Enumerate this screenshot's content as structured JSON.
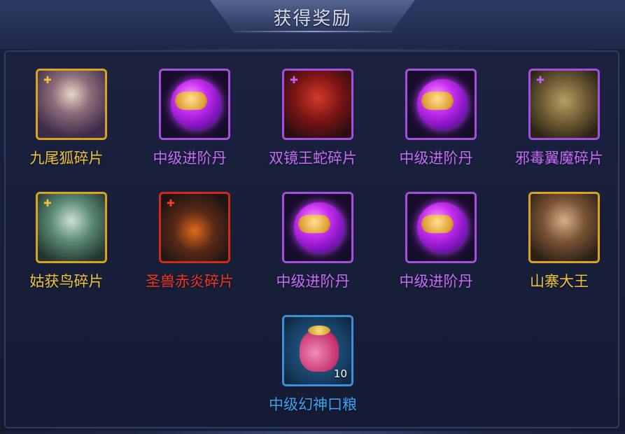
{
  "title": "获得奖励",
  "rewards": [
    {
      "name": "九尾狐碎片",
      "frame": "gold",
      "fragment": true,
      "art": "fox-portrait"
    },
    {
      "name": "中级进阶丹",
      "frame": "purple",
      "fragment": false,
      "art": "purple-orb"
    },
    {
      "name": "双镜王蛇碎片",
      "frame": "purple",
      "fragment": true,
      "art": "snake-portrait"
    },
    {
      "name": "中级进阶丹",
      "frame": "purple",
      "fragment": false,
      "art": "purple-orb"
    },
    {
      "name": "邪毒翼魔碎片",
      "frame": "purple",
      "fragment": true,
      "art": "winged-demon-portrait"
    },
    {
      "name": "姑获鸟碎片",
      "frame": "gold",
      "fragment": true,
      "art": "bird-spirit-portrait"
    },
    {
      "name": "圣兽赤炎碎片",
      "frame": "red",
      "fragment": true,
      "art": "flame-beast-portrait"
    },
    {
      "name": "中级进阶丹",
      "frame": "purple",
      "fragment": false,
      "art": "purple-orb"
    },
    {
      "name": "中级进阶丹",
      "frame": "purple",
      "fragment": false,
      "art": "purple-orb"
    },
    {
      "name": "山寨大王",
      "frame": "gold",
      "fragment": false,
      "art": "bandit-king-portrait"
    },
    {
      "name": "中级幻神口粮",
      "frame": "blue",
      "fragment": false,
      "art": "money-bag",
      "quantity": "10"
    }
  ],
  "colors": {
    "gold": "#f0c23a",
    "purple": "#c86cf8",
    "red": "#f03422",
    "blue": "#3aa4f2"
  }
}
